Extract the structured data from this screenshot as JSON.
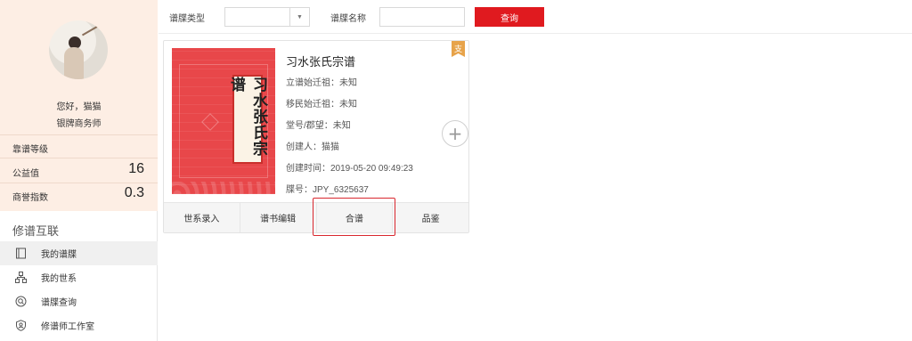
{
  "sidebar": {
    "greeting": "您好，猫猫",
    "role": "银牌商务师",
    "stats": [
      {
        "label": "靠谱等级",
        "value": ""
      },
      {
        "label": "公益值",
        "value": "16"
      },
      {
        "label": "商誉指数",
        "value": "0.3"
      }
    ],
    "section_title": "修谱互联",
    "items": [
      {
        "label": "我的谱牒",
        "icon": "book-icon"
      },
      {
        "label": "我的世系",
        "icon": "tree-icon"
      },
      {
        "label": "谱牒查询",
        "icon": "search-icon"
      },
      {
        "label": "修谱师工作室",
        "icon": "shield-user-icon"
      }
    ]
  },
  "filters": {
    "type_label": "谱牒类型",
    "type_value": "",
    "name_label": "谱牒名称",
    "name_value": "",
    "search_label": "查询"
  },
  "card": {
    "cover_text": "习水张氏宗谱",
    "badge": "支",
    "title": "习水张氏宗谱",
    "fields": [
      "立谱始迁祖：未知",
      "移民始迁祖：未知",
      "堂号/郡望：未知",
      "创建人：猫猫",
      "创建时间：2019-05-20 09:49:23",
      "牒号：JPY_6325637"
    ],
    "actions": [
      "世系录入",
      "谱书编辑",
      "合谱",
      "品鉴"
    ]
  },
  "colors": {
    "accent": "#e01a1f",
    "profile_bg": "#fdeee4",
    "badge": "#e7a34a"
  }
}
